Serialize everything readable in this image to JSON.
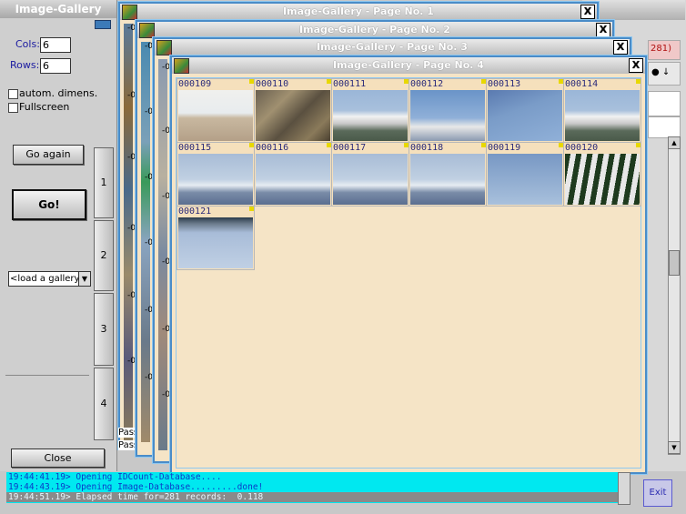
{
  "panel": {
    "title": "Image-Gallery",
    "cols_label": "Cols:",
    "cols_value": "6",
    "rows_label": "Rows:",
    "rows_value": "6",
    "autom_dimens_label": "autom. dimens.",
    "fullscreen_label": "Fullscreen",
    "go_again_label": "Go again",
    "go_label": "Go!",
    "page_buttons": [
      "1",
      "2",
      "3",
      "4"
    ],
    "gallery_select": "<load a gallery>",
    "close_label": "Close"
  },
  "windows": [
    {
      "title": "Image-Gallery - Page No. 1",
      "close": "X"
    },
    {
      "title": "Image-Gallery - Page No. 2",
      "close": "X"
    },
    {
      "title": "Image-Gallery - Page No. 3",
      "close": "X"
    },
    {
      "title": "Image-Gallery - Page No. 4",
      "close": "X"
    }
  ],
  "back_window": {
    "partial_text": "281)",
    "fragment_1": "Pass",
    "fragment_2": "Passer ("
  },
  "page4": {
    "thumbnails": [
      {
        "id": "000109",
        "scene": "beach-people"
      },
      {
        "id": "000110",
        "scene": "rocks-plant"
      },
      {
        "id": "000111",
        "scene": "white-houses"
      },
      {
        "id": "000112",
        "scene": "houses-sky"
      },
      {
        "id": "000113",
        "scene": "sky-branches"
      },
      {
        "id": "000114",
        "scene": "white-houses"
      },
      {
        "id": "000115",
        "scene": "sea-town"
      },
      {
        "id": "000116",
        "scene": "sea-town"
      },
      {
        "id": "000117",
        "scene": "sea-town"
      },
      {
        "id": "000118",
        "scene": "sea-town"
      },
      {
        "id": "000119",
        "scene": "sky"
      },
      {
        "id": "000120",
        "scene": "awning"
      },
      {
        "id": "000121",
        "scene": "awning-sky"
      }
    ]
  },
  "strip_labels": {
    "w1": [
      "-0",
      "-0",
      "-0",
      "-0",
      "-0",
      "-0",
      "-0",
      "-0"
    ],
    "w2": [
      "-0",
      "-0",
      "-0",
      "-0",
      "-0",
      "-0",
      "-0"
    ],
    "w3": [
      "-0",
      "-0",
      "-0",
      "-0",
      "-0",
      "-0",
      "-0"
    ]
  },
  "log": [
    "19:44:41.19> Opening IDCount-Database....",
    "19:44:43.19> Opening Image-Database.........done!",
    "19:44:51.19> Elapsed time for=281 records:  0.118"
  ],
  "exit_label": "Exit",
  "colors": {
    "window_border": "#4a8cc8",
    "window_bg": "#f5e4c6",
    "log_bg": "#00e8f0",
    "label_blue": "#1a1aa0"
  }
}
